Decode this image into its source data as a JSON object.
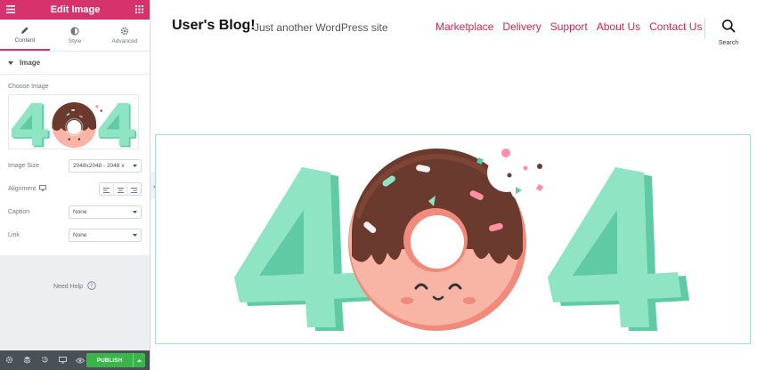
{
  "panel": {
    "title": "Edit Image",
    "tabs": [
      {
        "label": "Content",
        "icon": "pencil-icon"
      },
      {
        "label": "Style",
        "icon": "half-circle-icon"
      },
      {
        "label": "Advanced",
        "icon": "gear-icon"
      }
    ],
    "section": {
      "title": "Image"
    },
    "choose_image_label": "Choose Image",
    "image_size": {
      "label": "Image Size",
      "value": "2048x2048 - 2048 x"
    },
    "alignment": {
      "label": "Alignment"
    },
    "caption": {
      "label": "Caption",
      "value": "None"
    },
    "link": {
      "label": "Link",
      "value": "None"
    },
    "help_label": "Need Help",
    "publish_label": "PUBLISH"
  },
  "site": {
    "title": "User's Blog!",
    "tagline": "Just another WordPress site",
    "nav": [
      "Marketplace",
      "Delivery",
      "Support",
      "About Us",
      "Contact Us"
    ],
    "search_label": "Search"
  },
  "colors": {
    "brand_pink": "#d6336c",
    "nav_link": "#cd2653",
    "publish_green": "#39b54a",
    "digit_mint": "#8ee4c3",
    "digit_shadow": "#5fcaa3",
    "donut_pink": "#f8b4a4",
    "chocolate": "#6b3a2e"
  }
}
